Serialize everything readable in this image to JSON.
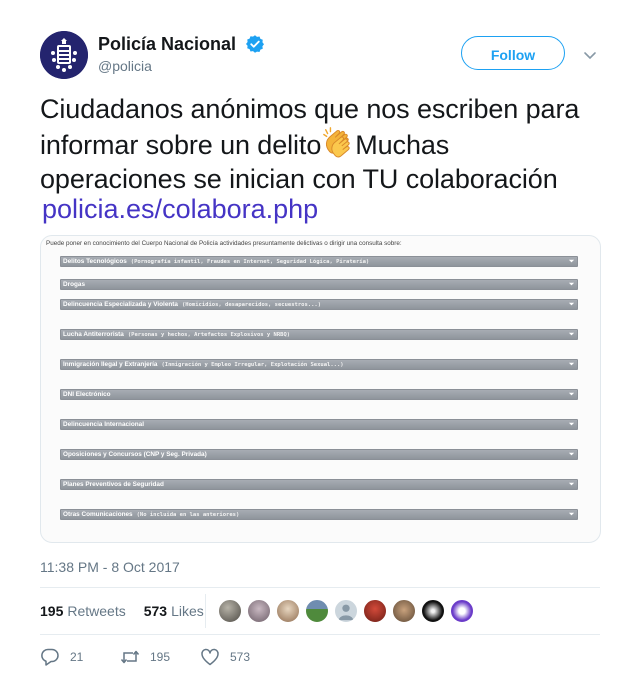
{
  "header": {
    "display_name": "Policía Nacional",
    "handle": "@policia",
    "follow_label": "Follow",
    "verified_icon": "verified-badge-icon"
  },
  "tweet": {
    "text_line1": "Ciudadanos anónimos que nos escriben para",
    "text_line2_a": "informar sobre un delito",
    "emoji": "clapping-hands-icon",
    "text_line2_b": "Muchas",
    "text_line3": "operaciones se inician con TU colaboración",
    "link": "policia.es/colabora.php"
  },
  "media": {
    "intro": "Puede poner en conocimiento del Cuerpo Nacional de Policía actividades presuntamente delictivas o dirigir una consulta sobre:",
    "items": [
      {
        "label": "Delitos Tecnológicos",
        "sub": "(Pornografía infantil, Fraudes en Internet, Seguridad Lógica, Piratería)"
      },
      {
        "label": "Drogas",
        "sub": ""
      },
      {
        "label": "Delincuencia Especializada y Violenta",
        "sub": "(Homicidios, desaparecidos, secuestros...)"
      },
      {
        "label": "Lucha Antiterrorista",
        "sub": "(Personas y hechos, Artefactos Explosivos y NRBQ)"
      },
      {
        "label": "Inmigración Ilegal y Extranjería",
        "sub": "(Inmigración y Empleo Irregular, Explotación Sexual...)"
      },
      {
        "label": "DNI Electrónico",
        "sub": ""
      },
      {
        "label": "Delincuencia Internacional",
        "sub": ""
      },
      {
        "label": "Oposiciones y Concursos (CNP y Seg. Privada)",
        "sub": ""
      },
      {
        "label": "Planes Preventivos de Seguridad",
        "sub": ""
      },
      {
        "label": "Otras Comunicaciones",
        "sub": "(No incluida en las anteriores)"
      }
    ]
  },
  "timestamp": "11:38 PM - 8 Oct 2017",
  "stats": {
    "retweets_count": "195",
    "retweets_label": "Retweets",
    "likes_count": "573",
    "likes_label": "Likes"
  },
  "actions": {
    "reply_count": "21",
    "retweet_count": "195",
    "like_count": "573"
  },
  "colors": {
    "accent": "#1da1f2",
    "link": "#4534c5",
    "muted": "#657786"
  }
}
